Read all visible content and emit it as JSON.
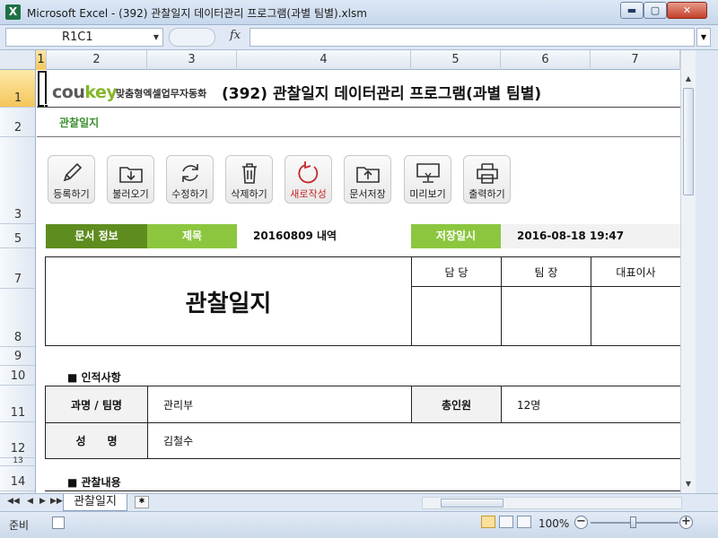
{
  "window": {
    "title": "Microsoft Excel - (392) 관찰일지 데이터관리 프로그램(과별 팀별).xlsm",
    "app_icon": "X",
    "minimize": "▬",
    "maximize": "▢",
    "close": "✕"
  },
  "formula_bar": {
    "name_box": "R1C1",
    "fx": "fx",
    "formula": ""
  },
  "columns": [
    "1",
    "2",
    "3",
    "4",
    "5",
    "6",
    "7"
  ],
  "rows": [
    "1",
    "2",
    "3",
    "5",
    "7",
    "8",
    "9",
    "10",
    "11",
    "12",
    "13",
    "14"
  ],
  "sheet": {
    "logo_co": "cou",
    "logo_key": "key",
    "tagline": "맞춤형엑셀업무자동화",
    "title": "(392) 관찰일지 데이터관리 프로그램(과별 팀별)",
    "subtitle": "관찰일지",
    "toolbar": [
      {
        "label": "등록하기",
        "icon": "pencil-icon"
      },
      {
        "label": "불러오기",
        "icon": "folder-download-icon"
      },
      {
        "label": "수정하기",
        "icon": "refresh-icon"
      },
      {
        "label": "삭제하기",
        "icon": "trash-icon"
      },
      {
        "label": "새로작성",
        "icon": "restart-icon"
      },
      {
        "label": "문서저장",
        "icon": "folder-upload-icon"
      },
      {
        "label": "미리보기",
        "icon": "monitor-icon"
      },
      {
        "label": "출력하기",
        "icon": "printer-icon"
      }
    ],
    "info": {
      "doc_info_label": "문서 정보",
      "subject_label": "제목",
      "subject_value": "20160809 내역",
      "saved_label": "저장일시",
      "saved_value": "2016-08-18 19:47"
    },
    "form_title": "관찰일지",
    "approval": [
      "담 당",
      "팀 장",
      "대표이사"
    ],
    "section_personal": "■ 인적사항",
    "personal": {
      "dept_label": "과명 / 팀명",
      "dept_value": "관리부",
      "total_label": "총인원",
      "total_value": "12명",
      "name_label": "성　　명",
      "name_value": "김철수"
    },
    "section_observation": "■ 관찰내용"
  },
  "tabs": {
    "sheet_tab": "관찰일지",
    "nav_first": "◀◀",
    "nav_prev": "◀",
    "nav_next": "▶",
    "nav_last": "▶▶"
  },
  "status": {
    "ready": "준비",
    "zoom": "100%",
    "zoom_minus": "−",
    "zoom_plus": "+"
  },
  "colors": {
    "dark_green": "#5f8c1f",
    "light_green": "#8cc63f",
    "accent_red": "#c62828"
  }
}
